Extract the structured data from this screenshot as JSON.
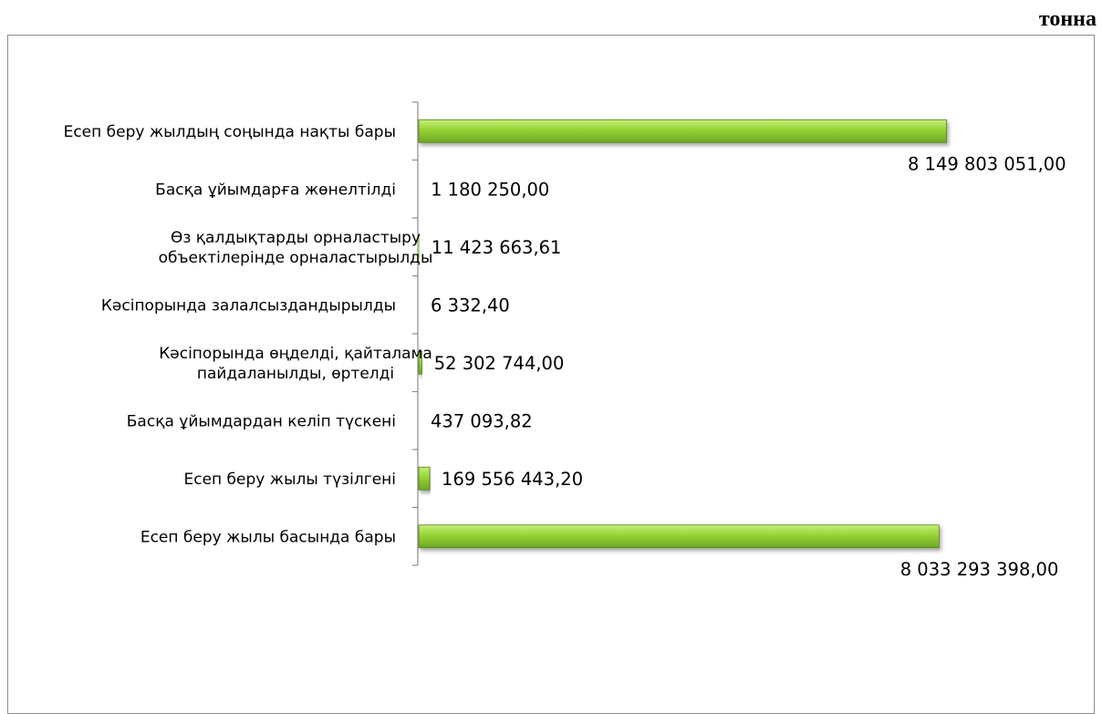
{
  "unit_label": "тонна",
  "colors": {
    "bar_light": "#c7ef7a",
    "bar_mid": "#96d334",
    "bar_dark": "#6ea827",
    "bar_edge": "#567f1f",
    "axis": "#8c8c8c"
  },
  "chart_data": {
    "type": "bar",
    "orientation": "horizontal",
    "categories": [
      [
        "Есеп беру жылы басында бары"
      ],
      [
        "Есеп беру жылы түзілгені"
      ],
      [
        "Басқа ұйымдардан келіп түскені"
      ],
      [
        "Кәсіпорында өңделді, қайталама",
        "пайдаланылды, өртелді"
      ],
      [
        "Кәсіпорында залалсыздандырылды"
      ],
      [
        "Өз қалдықтарды орналастыру",
        "объектілерінде орналастырылды"
      ],
      [
        "Басқа ұйымдарға жөнелтілді"
      ],
      [
        "Есеп беру жылдың соңында нақты бары"
      ]
    ],
    "values": [
      8033293398.0,
      169556443.2,
      437093.82,
      52302744.0,
      6332.4,
      11423663.61,
      1180250.0,
      8149803051.0
    ],
    "data_labels": [
      "8 033 293 398,00",
      "169 556 443,20",
      "437 093,82",
      "52 302 744,00",
      "6 332,40",
      "11 423 663,61",
      "1 180 250,00",
      "8 149 803 051,00"
    ],
    "xlim": [
      0,
      10000000000
    ],
    "grid": false,
    "legend": "none"
  }
}
